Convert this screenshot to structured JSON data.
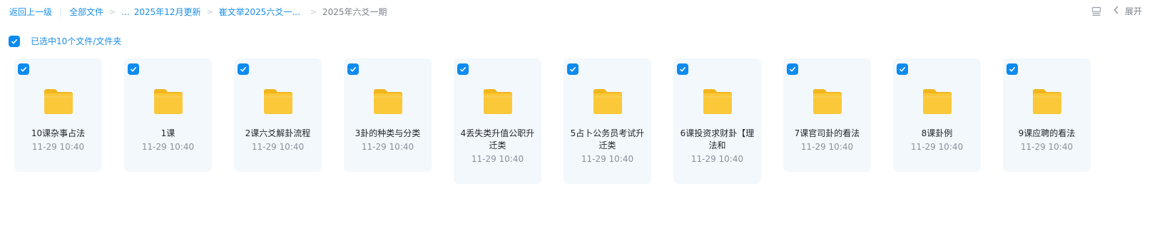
{
  "breadcrumb": {
    "back": "返回上一级",
    "all_files": "全部文件",
    "ellipsis": "...",
    "level1": "2025年12月更新",
    "level2": "崔文举2025六爻一...",
    "current": "2025年六爻一期"
  },
  "header_actions": {
    "expand_label": "展开",
    "icons": [
      "list-view-icon",
      "chevron-left-icon"
    ]
  },
  "selection": {
    "label": "已选中10个文件/文件夹",
    "checked": true
  },
  "colors": {
    "accent": "#0d8bef",
    "card_bg": "#f2f8fc",
    "folder": "#f8c630"
  },
  "folders": [
    {
      "name": "10课杂事占法",
      "time": "11-29 10:40",
      "checked": true
    },
    {
      "name": "1课",
      "time": "11-29 10:40",
      "checked": true
    },
    {
      "name": "2课六爻解卦流程",
      "time": "11-29 10:40",
      "checked": true
    },
    {
      "name": "3卦的种类与分类",
      "time": "11-29 10:40",
      "checked": true
    },
    {
      "name": "4丢失类升值公职升迁类",
      "time": "11-29 10:40",
      "checked": true
    },
    {
      "name": "5占卜公务员考试升迁类",
      "time": "11-29 10:40",
      "checked": true
    },
    {
      "name": "6课投资求财卦【理法和",
      "time": "11-29 10:40",
      "checked": true
    },
    {
      "name": "7课官司卦的看法",
      "time": "11-29 10:40",
      "checked": true
    },
    {
      "name": "8课卦例",
      "time": "11-29 10:40",
      "checked": true
    },
    {
      "name": "9课应聘的看法",
      "time": "11-29 10:40",
      "checked": true
    }
  ]
}
